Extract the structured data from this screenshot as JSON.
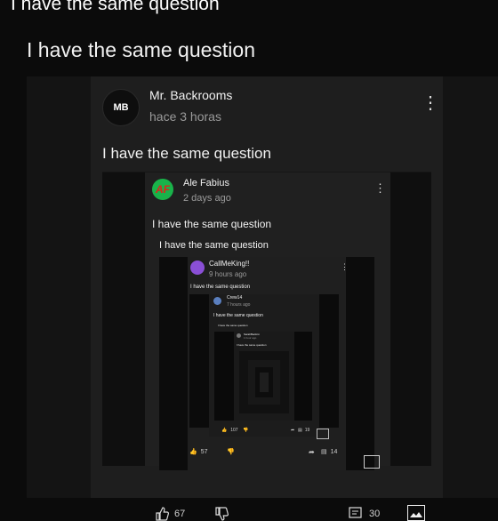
{
  "meme_caption_top": "I have the same question",
  "caption": "I have the same question",
  "level1": {
    "author": "Mr. Backrooms",
    "avatar_text": "MB",
    "time": "hace 3 horas",
    "comment": "I have the same question",
    "likes": "67",
    "replies": "30"
  },
  "level2": {
    "author": "Ale Fabius",
    "avatar_text": "AF",
    "time": "2 days ago",
    "comment": "I have the same question",
    "caption": "I have the same question"
  },
  "level3": {
    "author": "CallMeKing!!",
    "time": "9 hours ago",
    "comment": "I have the same question",
    "likes": "57",
    "replies": "14"
  },
  "level4": {
    "author": "Crew14",
    "time": "7 hours ago",
    "comment": "I have the same question",
    "caption": "I have the same question",
    "likes": "107",
    "replies": "19"
  },
  "level5": {
    "author": "SarahBackrm",
    "time": "1 hour ago",
    "comment": "I have the same question"
  },
  "colors": {
    "background": "#0b0b0b",
    "card": "#1c1c1c",
    "avatar_mb": "#111111",
    "avatar_af_ring": "#19b34a",
    "avatar_af_text": "#e0201e",
    "avatar_king": "#8a4fd6"
  }
}
